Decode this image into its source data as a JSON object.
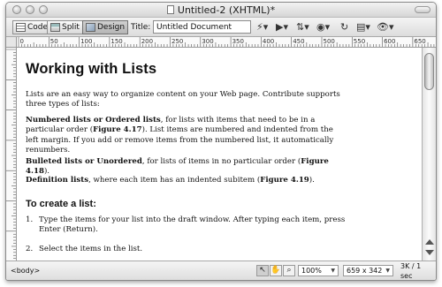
{
  "window": {
    "title": "Untitled-2 (XHTML)*"
  },
  "toolbar": {
    "views": [
      {
        "label": "Code",
        "icon": "code-view-icon"
      },
      {
        "label": "Split",
        "icon": "split-view-icon"
      },
      {
        "label": "Design",
        "icon": "design-view-icon",
        "active": true
      }
    ],
    "title_label": "Title:",
    "title_value": "Untitled Document"
  },
  "ruler": {
    "marks": [
      "0",
      "50",
      "100",
      "150",
      "200",
      "250",
      "300",
      "350",
      "400",
      "450",
      "500",
      "550",
      "600",
      "650"
    ]
  },
  "document": {
    "heading": "Working with Lists",
    "intro": "Lists are an easy way to organize content on your Web page. Contribute supports three types of lists:",
    "numbered_term": "Numbered lists or Ordered lists",
    "numbered_text_1": ", for lists with items that need to be in a particular order (",
    "numbered_figure": "Figure 4.17",
    "numbered_text_2": "). List items are numbered and indented from the left margin. If you add or remove items from the numbered list, it automatically renumbers.",
    "bulleted_term": "Bulleted lists or Unordered",
    "bulleted_text": ", for lists of items in no particular order (",
    "bulleted_figure": "Figure 4.18",
    "bulleted_end": ").",
    "definition_term": "Definition lists",
    "definition_text": ", where each item has an indented subitem (",
    "definition_figure": "Figure 4.19",
    "definition_end": ").",
    "subheading": "To create a list:",
    "steps": [
      {
        "num": "1.",
        "text": "Type the items for your list into the draft window. After typing each item, press Enter (Return)."
      },
      {
        "num": "2.",
        "text": "Select the items in the list."
      }
    ]
  },
  "statusbar": {
    "tag": "<body>",
    "zoom": "100%",
    "window_size": "659 x 342",
    "download": "3K / 1 sec"
  }
}
